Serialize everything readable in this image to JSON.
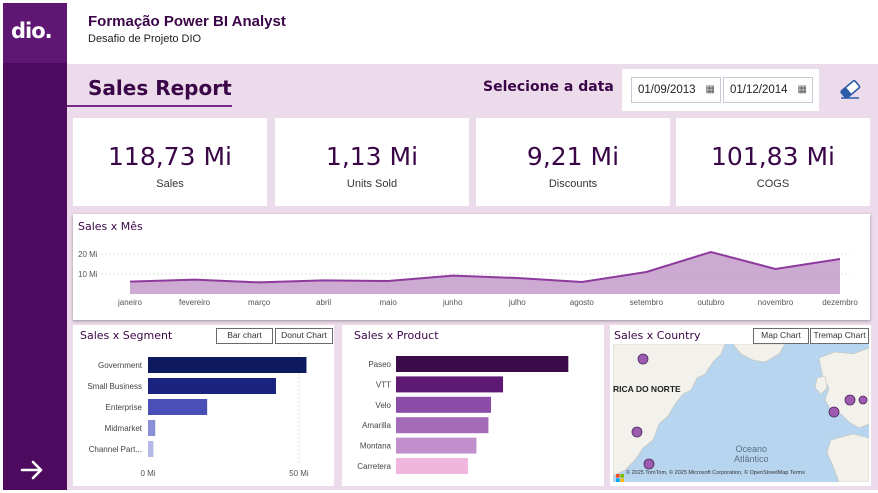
{
  "header": {
    "logo_text": "dio.",
    "course_title": "Formação Power BI Analyst",
    "course_subtitle": "Desafio de Projeto DIO"
  },
  "report": {
    "title": "Sales Report",
    "date_label": "Selecione a data",
    "date_start": "01/09/2013",
    "date_end": "01/12/2014"
  },
  "kpis": [
    {
      "value": "118,73 Mi",
      "label": "Sales"
    },
    {
      "value": "1,13 Mi",
      "label": "Units Sold"
    },
    {
      "value": "9,21 Mi",
      "label": "Discounts"
    },
    {
      "value": "101,83 Mi",
      "label": "COGS"
    }
  ],
  "colors": {
    "rail": "#4d0a5e",
    "band": "#ecdbea",
    "title": "#3a0648",
    "line": "#8e3a9c",
    "area": "#c7a1cd"
  },
  "sales_month": {
    "title": "Sales x Mês"
  },
  "segment": {
    "title": "Sales x Segment",
    "toggle_bar": "Bar chart",
    "toggle_donut": "Donut Chart"
  },
  "product": {
    "title": "Sales x Product"
  },
  "country": {
    "title": "Sales x Country",
    "toggle_map": "Map Chart",
    "toggle_treemap": "Tremap Chart",
    "map_label_region": "RICA DO NORTE",
    "map_label_ocean_1": "Oceano",
    "map_label_ocean_2": "Atlântico",
    "credit": "© 2025 TomTom, © 2025 Microsoft Corporation, © OpenStreetMap  Terms"
  },
  "chart_data": [
    {
      "type": "area",
      "title": "Sales x Mês",
      "categories": [
        "janeiro",
        "fevereiro",
        "março",
        "abril",
        "maio",
        "junho",
        "julho",
        "agosto",
        "setembro",
        "outubro",
        "novembro",
        "dezembro"
      ],
      "values": [
        6.2,
        7.2,
        5.8,
        6.8,
        6.5,
        9.2,
        8.0,
        6.0,
        11.0,
        21.0,
        12.5,
        17.5
      ],
      "ylabel": "",
      "y_ticks": [
        "10 Mi",
        "20 Mi"
      ],
      "y_tick_values": [
        10,
        20
      ],
      "ylim": [
        0,
        25
      ],
      "grid": true
    },
    {
      "type": "bar",
      "orientation": "horizontal",
      "title": "Sales x Segment",
      "categories": [
        "Government",
        "Small Business",
        "Enterprise",
        "Midmarket",
        "Channel Part..."
      ],
      "values": [
        52.5,
        42.4,
        19.6,
        2.4,
        1.8
      ],
      "colors": [
        "#0d1b5e",
        "#1a237e",
        "#4a4fb8",
        "#8a8fd6",
        "#b4b8e6"
      ],
      "x_ticks": [
        "0 Mi",
        "50 Mi"
      ],
      "x_tick_values": [
        0,
        50
      ],
      "xlim": [
        0,
        55
      ]
    },
    {
      "type": "bar",
      "orientation": "horizontal",
      "title": "Sales x Product",
      "categories": [
        "Paseo",
        "VTT",
        "Velo",
        "Amarilla",
        "Montana",
        "Carretera"
      ],
      "values": [
        33.0,
        20.5,
        18.2,
        17.7,
        15.4,
        13.8
      ],
      "colors": [
        "#3b0a4a",
        "#5e1a72",
        "#8a4ca6",
        "#a56ab8",
        "#c08fcc",
        "#f0b6dd"
      ],
      "xlim": [
        0,
        36
      ]
    }
  ]
}
